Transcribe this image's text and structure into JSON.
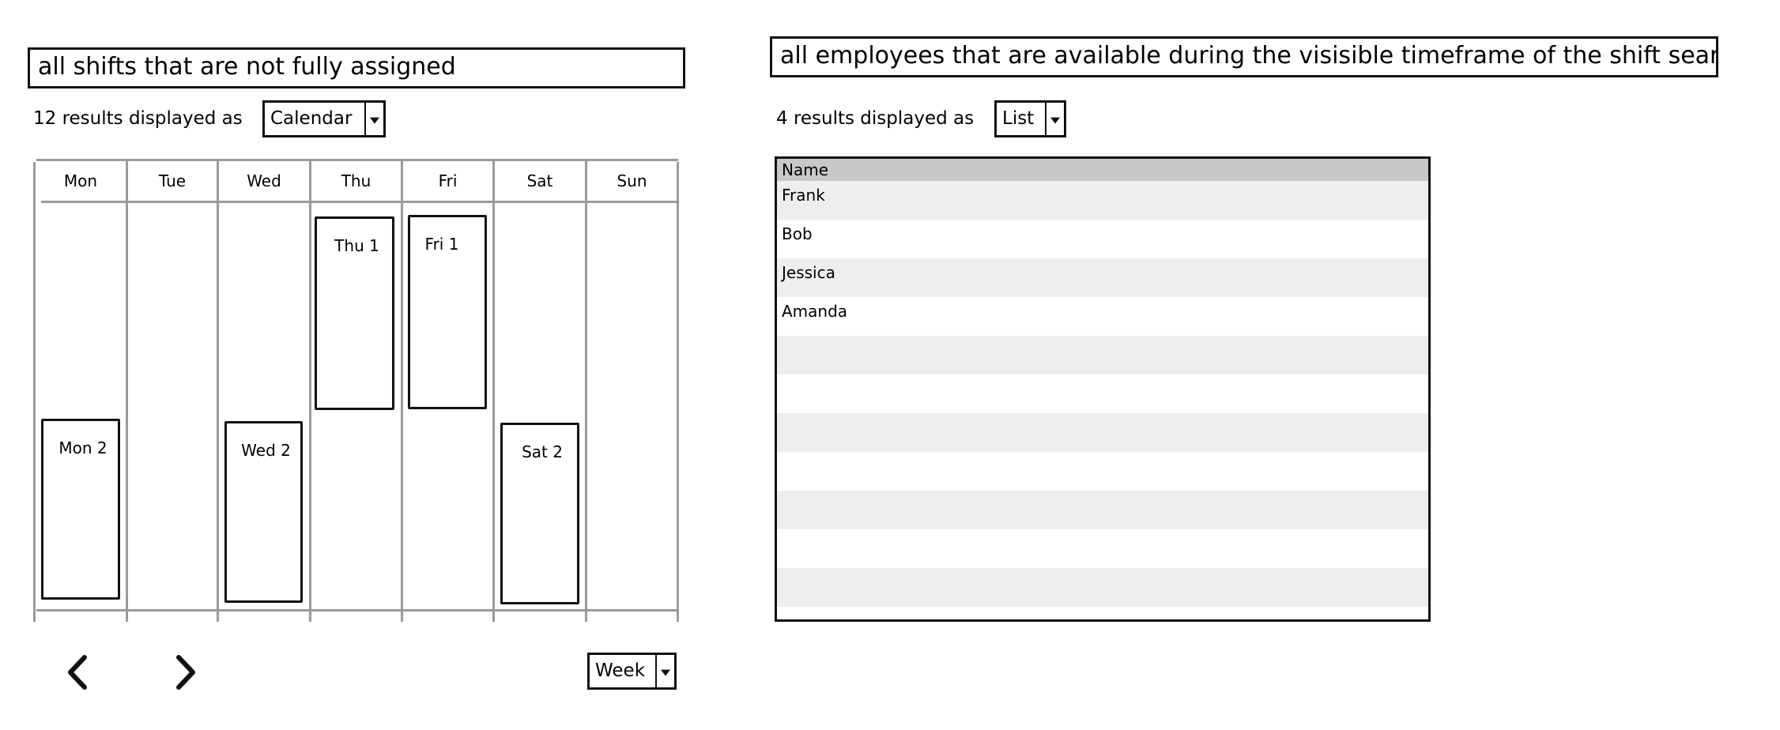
{
  "shifts_panel": {
    "title": "all shifts that are not fully assigned",
    "results_text": "12 results displayed as",
    "view_select": {
      "selected": "Calendar"
    },
    "calendar": {
      "days": [
        "Mon",
        "Tue",
        "Wed",
        "Thu",
        "Fri",
        "Sat",
        "Sun"
      ],
      "shifts": [
        {
          "label": "Mon 2",
          "day": "Mon"
        },
        {
          "label": "Wed 2",
          "day": "Wed"
        },
        {
          "label": "Thu 1",
          "day": "Thu"
        },
        {
          "label": "Fri 1",
          "day": "Fri"
        },
        {
          "label": "Sat 2",
          "day": "Sat"
        }
      ]
    },
    "navigation": {
      "prev_icon": "chevron-left-icon",
      "next_icon": "chevron-right-icon",
      "range_select": {
        "selected": "Week"
      }
    }
  },
  "employees_panel": {
    "title": "all employees that are available during the visisible timeframe of the shift search",
    "results_text": "4 results displayed as",
    "view_select": {
      "selected": "List"
    },
    "table": {
      "columns": [
        "Name"
      ],
      "rows": [
        "Frank",
        "Bob",
        "Jessica",
        "Amanda",
        "",
        "",
        "",
        "",
        "",
        "",
        "",
        ""
      ]
    }
  }
}
